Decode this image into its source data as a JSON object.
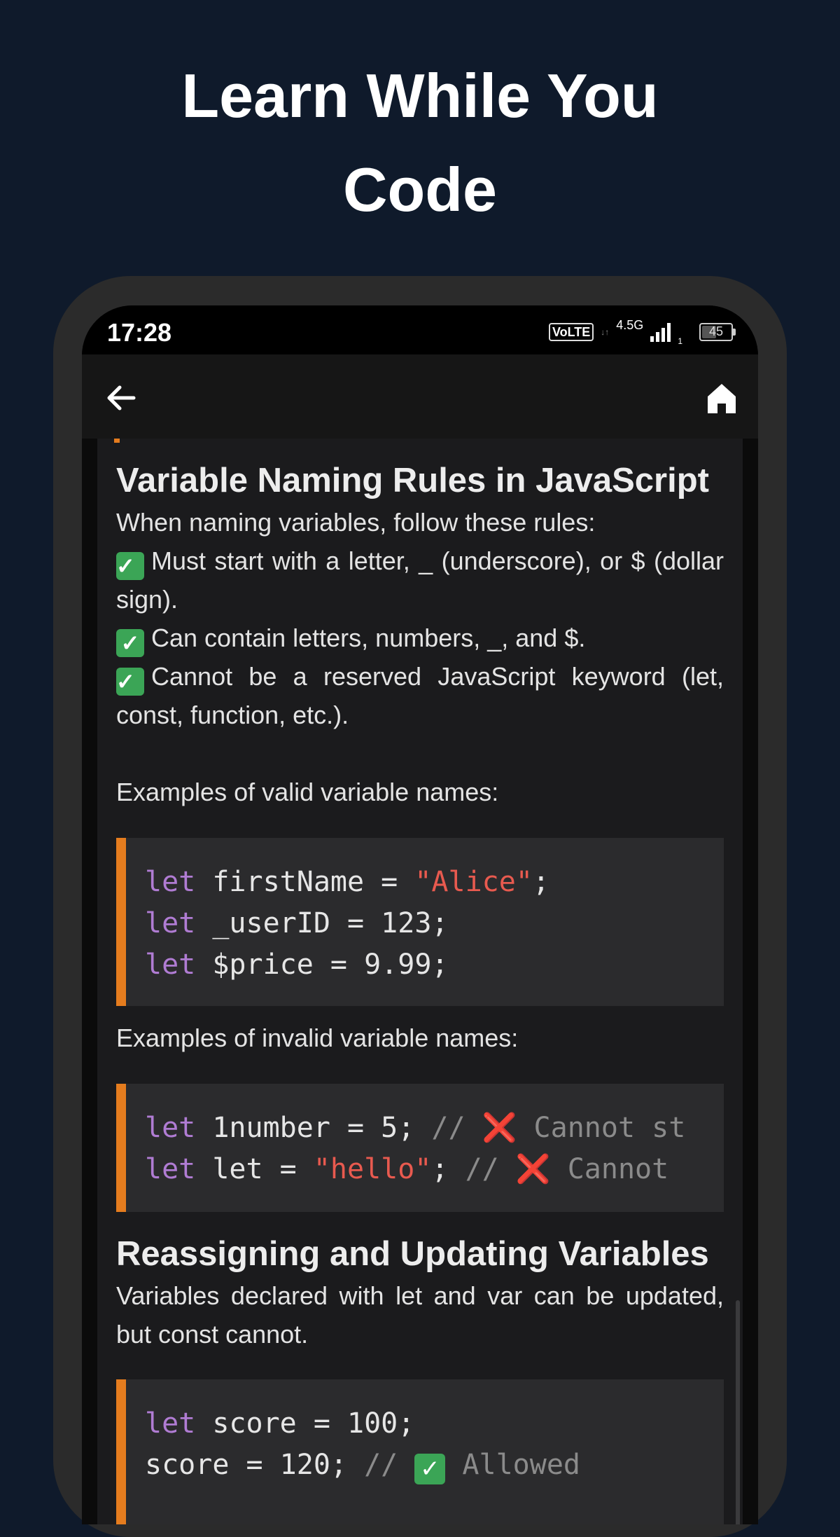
{
  "promo": {
    "title_line1": "Learn While You",
    "title_line2": "Code"
  },
  "status_bar": {
    "time": "17:28",
    "volte": "VoLTE",
    "network": "4.5G",
    "sim": "1",
    "battery": "45"
  },
  "app_bar": {
    "back_icon": "arrow-left-icon",
    "home_icon": "home-icon"
  },
  "lesson": {
    "heading1": "Variable Naming Rules in JavaScript",
    "intro": "When naming variables, follow these rules:",
    "rules": [
      "Must start with a letter, _ (underscore), or $ (dollar sign).",
      "Can contain letters, numbers, _, and $.",
      "Cannot be a reserved JavaScript keyword (let, const, function, etc.)."
    ],
    "valid_label": "Examples of valid variable names:",
    "valid_code": [
      {
        "kw": "let",
        "text": " firstName = ",
        "str": "\"Alice\"",
        "end": ";"
      },
      {
        "kw": "let",
        "text": " _userID = 123;",
        "str": "",
        "end": ""
      },
      {
        "kw": "let",
        "text": " $price = 9.99;",
        "str": "",
        "end": ""
      }
    ],
    "invalid_label": "Examples of invalid variable names:",
    "invalid_code": [
      {
        "kw": "let",
        "text": " 1number = 5; ",
        "comment": "// ",
        "mark": "❌",
        "comment_text": " Cannot st"
      },
      {
        "kw": "let",
        "text": " let = ",
        "str": "\"hello\"",
        "text2": "; ",
        "comment": "// ",
        "mark": "❌",
        "comment_text": " Cannot"
      }
    ],
    "heading2": "Reassigning and Updating Variables",
    "update_para": "Variables declared with let and var can be updated, but const cannot.",
    "update_code": [
      {
        "kw": "let",
        "text": " score = 100;"
      },
      {
        "text": "score = 120; ",
        "comment": "// ",
        "mark": "✓",
        "comment_text": " Allowed"
      }
    ]
  }
}
